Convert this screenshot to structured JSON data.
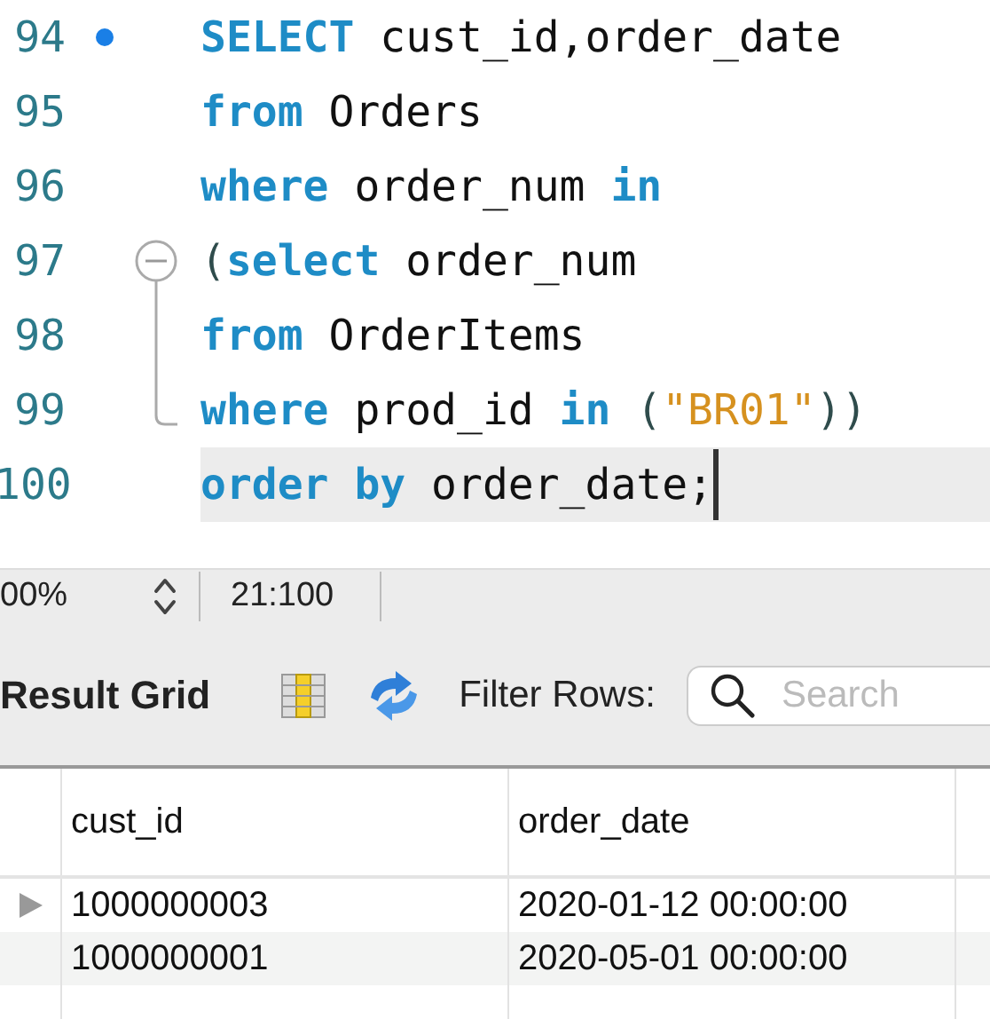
{
  "editor": {
    "lines": [
      {
        "number": "94",
        "current": false,
        "kind": "bookmark",
        "tokens": [
          {
            "kind": "kw",
            "text": "SELECT"
          },
          {
            "kind": "id",
            "text": " cust_id,order_date"
          }
        ]
      },
      {
        "number": "95",
        "current": false,
        "kind": "plain",
        "tokens": [
          {
            "kind": "kw",
            "text": "from"
          },
          {
            "kind": "id",
            "text": " Orders"
          }
        ]
      },
      {
        "number": "96",
        "current": false,
        "kind": "plain",
        "tokens": [
          {
            "kind": "kw",
            "text": "where"
          },
          {
            "kind": "id",
            "text": " order_num "
          },
          {
            "kind": "kw",
            "text": "in"
          }
        ]
      },
      {
        "number": "97",
        "current": false,
        "kind": "fold-start",
        "tokens": [
          {
            "kind": "punct",
            "text": "("
          },
          {
            "kind": "kw",
            "text": "select"
          },
          {
            "kind": "id",
            "text": " order_num"
          }
        ]
      },
      {
        "number": "98",
        "current": false,
        "kind": "fold-mid",
        "tokens": [
          {
            "kind": "kw",
            "text": "from"
          },
          {
            "kind": "id",
            "text": " OrderItems"
          }
        ]
      },
      {
        "number": "99",
        "current": false,
        "kind": "fold-end",
        "tokens": [
          {
            "kind": "kw",
            "text": "where"
          },
          {
            "kind": "id",
            "text": " prod_id "
          },
          {
            "kind": "kw",
            "text": "in"
          },
          {
            "kind": "punct",
            "text": " ("
          },
          {
            "kind": "str",
            "text": "\"BR01\""
          },
          {
            "kind": "punct",
            "text": "))"
          }
        ]
      },
      {
        "number": "100",
        "current": true,
        "kind": "plain",
        "tokens": [
          {
            "kind": "kw",
            "text": "order by"
          },
          {
            "kind": "id",
            "text": " order_date;"
          }
        ]
      }
    ]
  },
  "status_bar": {
    "zoom": "00%",
    "position": "21:100"
  },
  "result_toolbar": {
    "title": "Result Grid",
    "filter_label": "Filter Rows:",
    "search": {
      "placeholder": "Search"
    }
  },
  "table": {
    "columns": [
      "cust_id",
      "order_date"
    ],
    "rows": [
      {
        "selected": true,
        "cells": [
          "1000000003",
          "2020-01-12 00:00:00"
        ]
      },
      {
        "selected": false,
        "cells": [
          "1000000001",
          "2020-05-01 00:00:00"
        ]
      }
    ]
  }
}
